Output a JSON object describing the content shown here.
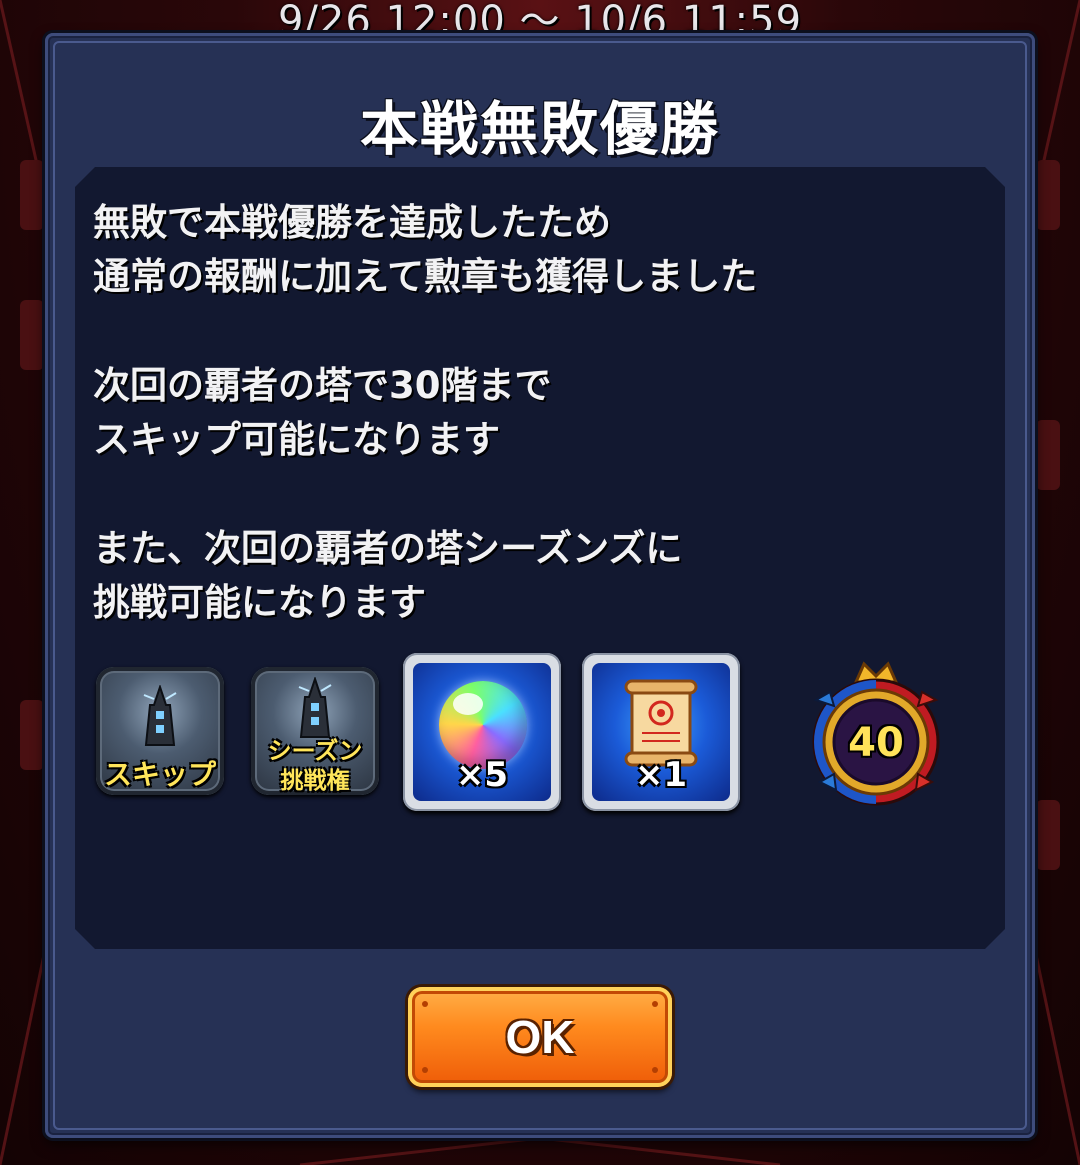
{
  "header": {
    "date_range": "9/26 12:00 ～ 10/6 11:59"
  },
  "dialog": {
    "title": "本戦無敗優勝",
    "message_lines": [
      "無敗で本戦優勝を達成したため",
      "通常の報酬に加えて勲章も獲得しました",
      "",
      "次回の覇者の塔で30階まで",
      "スキップ可能になります",
      "",
      "また、次回の覇者の塔シーズンズに",
      "挑戦可能になります"
    ],
    "rewards": {
      "skip_ticket": {
        "label": "スキップ",
        "icon": "tower-skip-icon"
      },
      "season_ticket": {
        "label_line1": "シーズン",
        "label_line2": "挑戦権",
        "icon": "tower-season-icon"
      },
      "orb": {
        "count": "×5",
        "icon": "rainbow-orb-icon"
      },
      "scroll": {
        "count": "×1",
        "icon": "scroll-icon"
      },
      "medal": {
        "value": "40",
        "icon": "medal-icon"
      }
    },
    "ok_label": "OK"
  },
  "colors": {
    "dialog_bg": "#263155",
    "panel_bg": "#121830",
    "button_orange": "#ff8a1e",
    "label_yellow": "#ffe55a"
  }
}
